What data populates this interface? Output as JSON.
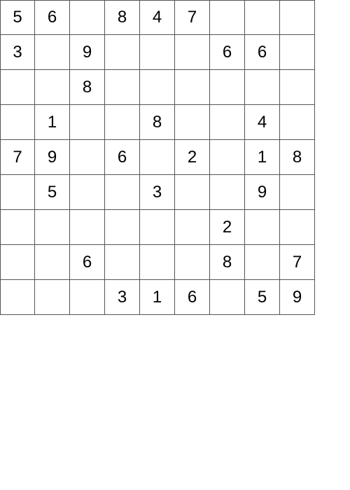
{
  "board": {
    "rows": [
      [
        "5",
        "6",
        "",
        "8",
        "4",
        "7",
        "",
        "",
        ""
      ],
      [
        "3",
        "",
        "9",
        "",
        "",
        "",
        "6",
        "6",
        ""
      ],
      [
        "",
        "",
        "8",
        "",
        "",
        "",
        "",
        "",
        ""
      ],
      [
        "",
        "1",
        "",
        "",
        "8",
        "",
        "",
        "4",
        ""
      ],
      [
        "7",
        "9",
        "",
        "6",
        "",
        "2",
        "",
        "1",
        "8"
      ],
      [
        "",
        "5",
        "",
        "",
        "3",
        "",
        "",
        "9",
        ""
      ],
      [
        "",
        "",
        "",
        "",
        "",
        "",
        "2",
        "",
        ""
      ],
      [
        "",
        "",
        "6",
        "",
        "",
        "",
        "8",
        "",
        "7"
      ],
      [
        "",
        "",
        "",
        "3",
        "1",
        "6",
        "",
        "5",
        "9"
      ]
    ],
    "line_color": "#555555"
  }
}
